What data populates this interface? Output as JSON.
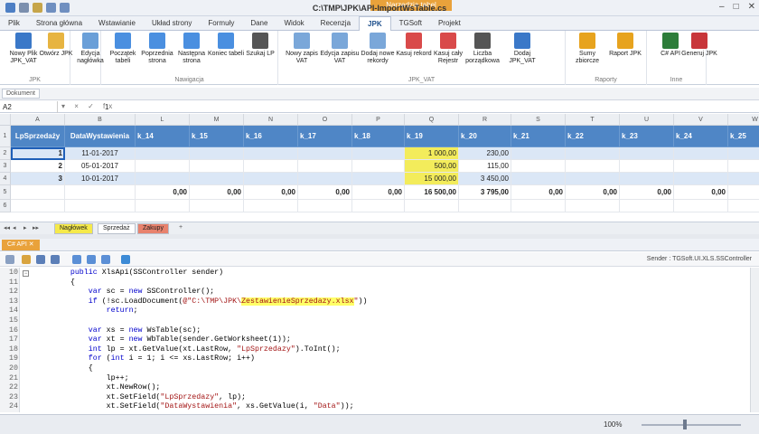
{
  "window": {
    "title": "C:\\TMP\\JPK\\API-ImportWsTable.cs",
    "context_label": "Narzędzia tabel",
    "controls": [
      "–",
      "□",
      "✕"
    ]
  },
  "tabs": [
    "Plik",
    "Strona główna",
    "Wstawianie",
    "Układ strony",
    "Formuły",
    "Dane",
    "Widok",
    "Recenzja",
    "JPK",
    "TGSoft",
    "Projekt"
  ],
  "active_tab": "JPK",
  "ribbon": {
    "groups": [
      {
        "label": "JPK",
        "buttons": [
          {
            "label": "Nowy Plik JPK_VAT",
            "icon": "new-file-icon",
            "color": "#3a78c8"
          },
          {
            "label": "Otwórz JPK",
            "icon": "open-folder-icon",
            "color": "#e7b441"
          }
        ]
      },
      {
        "label": "",
        "buttons": [
          {
            "label": "Edycja nagłówka",
            "icon": "edit-header-icon",
            "color": "#6a9fd8"
          }
        ]
      },
      {
        "label": "Nawigacja",
        "buttons": [
          {
            "label": "Początek tabeli",
            "icon": "first-page-icon",
            "color": "#4a8fe0"
          },
          {
            "label": "Poprzednia strona",
            "icon": "previous-page-icon",
            "color": "#4a8fe0"
          },
          {
            "label": "Następna strona",
            "icon": "next-page-icon",
            "color": "#4a8fe0"
          },
          {
            "label": "Koniec tabeli",
            "icon": "last-page-icon",
            "color": "#4a8fe0"
          },
          {
            "label": "Szukaj LP",
            "icon": "binoculars-icon",
            "color": "#555555"
          }
        ]
      },
      {
        "label": "JPK_VAT",
        "buttons": [
          {
            "label": "Nowy zapis VAT",
            "icon": "new-record-icon",
            "color": "#7aa7d9"
          },
          {
            "label": "Edycja zapisu VAT",
            "icon": "edit-record-icon",
            "color": "#7aa7d9"
          },
          {
            "label": "Dodaj nowe rekordy",
            "icon": "add-records-icon",
            "color": "#7aa7d9"
          },
          {
            "label": "Kasuj rekord",
            "icon": "delete-record-icon",
            "color": "#d94a4a"
          },
          {
            "label": "Kasuj cały Rejestr",
            "icon": "delete-register-icon",
            "color": "#d94a4a"
          },
          {
            "label": "Liczba porządkowa",
            "icon": "numbered-list-icon",
            "color": "#555555"
          },
          {
            "label": "Dodaj JPK_VAT",
            "icon": "add-jpk-icon",
            "color": "#3a78c8"
          }
        ]
      },
      {
        "label": "Raporty",
        "buttons": [
          {
            "label": "Sumy zbiorcze",
            "icon": "sum-icon",
            "color": "#e7a31e"
          },
          {
            "label": "Raport JPK",
            "icon": "report-icon",
            "color": "#e7a31e"
          }
        ]
      },
      {
        "label": "Inne",
        "buttons": [
          {
            "label": "C# API",
            "icon": "csharp-icon",
            "color": "#2d7d3a"
          },
          {
            "label": "Generuj JPK",
            "icon": "generate-icon",
            "color": "#c8363a"
          }
        ]
      }
    ]
  },
  "document_tab": "Dokument",
  "formula_bar": {
    "cell_ref": "A2",
    "icons": "▾ × ✓ fx",
    "value": "1"
  },
  "sheet": {
    "col_letters": [
      "A",
      "B",
      "L",
      "M",
      "N",
      "O",
      "P",
      "Q",
      "R",
      "S",
      "T",
      "U",
      "V",
      "W"
    ],
    "row_numbers": [
      "1",
      "2",
      "3",
      "4",
      "5",
      "6"
    ],
    "header_row": [
      "LpSprzedaży",
      "DataWystawienia",
      "k_14",
      "k_15",
      "k_16",
      "k_17",
      "k_18",
      "k_19",
      "k_20",
      "k_21",
      "k_22",
      "k_23",
      "k_24",
      "k_25"
    ],
    "rows": [
      [
        "1",
        "11-01-2017",
        "",
        "",
        "",
        "",
        "",
        "1 000,00",
        "230,00",
        "",
        "",
        "",
        "",
        ""
      ],
      [
        "2",
        "05-01-2017",
        "",
        "",
        "",
        "",
        "",
        "500,00",
        "115,00",
        "",
        "",
        "",
        "",
        ""
      ],
      [
        "3",
        "10-01-2017",
        "",
        "",
        "",
        "",
        "",
        "15 000,00",
        "3 450,00",
        "",
        "",
        "",
        "",
        ""
      ],
      [
        "",
        "",
        "0,00",
        "0,00",
        "0,00",
        "0,00",
        "0,00",
        "16 500,00",
        "3 795,00",
        "0,00",
        "0,00",
        "0,00",
        "0,00",
        "0,00"
      ],
      [
        "",
        "",
        "",
        "",
        "",
        "",
        "",
        "",
        "",
        "",
        "",
        "",
        "",
        ""
      ]
    ]
  },
  "sheet_tabs": [
    {
      "label": "Nagłówek",
      "color": "#f5e94a"
    },
    {
      "label": "Sprzedaż",
      "color": "#ffffff"
    },
    {
      "label": "Zakupy",
      "color": "#e8826d"
    }
  ],
  "sheet_nav": [
    "◂◂",
    "◂",
    "▸",
    "▸▸",
    "+"
  ],
  "code_panel": {
    "tab": "C# API",
    "sender_label": "Sender : TGSoft.UI.XLS.SSController"
  },
  "code_lines": [
    {
      "n": "10",
      "segs": [
        {
          "t": "        ",
          "c": ""
        },
        {
          "t": "public",
          "c": "kw"
        },
        {
          "t": " XlsApi(SSController sender)",
          "c": ""
        }
      ]
    },
    {
      "n": "11",
      "segs": [
        {
          "t": "        {",
          "c": ""
        }
      ]
    },
    {
      "n": "12",
      "segs": [
        {
          "t": "            ",
          "c": ""
        },
        {
          "t": "var",
          "c": "kw"
        },
        {
          "t": " sc = ",
          "c": ""
        },
        {
          "t": "new",
          "c": "kw"
        },
        {
          "t": " SSController();",
          "c": ""
        }
      ]
    },
    {
      "n": "13",
      "segs": [
        {
          "t": "            ",
          "c": ""
        },
        {
          "t": "if",
          "c": "kw"
        },
        {
          "t": " (!sc.LoadDocument(",
          "c": ""
        },
        {
          "t": "@\"C:\\TMP\\JPK\\",
          "c": "str"
        },
        {
          "t": "ZestawienieSprzedazy.xlsx",
          "c": "str hl"
        },
        {
          "t": "\"",
          "c": "str"
        },
        {
          "t": "))",
          "c": ""
        }
      ]
    },
    {
      "n": "14",
      "segs": [
        {
          "t": "                ",
          "c": ""
        },
        {
          "t": "return",
          "c": "kw"
        },
        {
          "t": ";",
          "c": ""
        }
      ]
    },
    {
      "n": "15",
      "segs": [
        {
          "t": "",
          "c": ""
        }
      ]
    },
    {
      "n": "16",
      "segs": [
        {
          "t": "            ",
          "c": ""
        },
        {
          "t": "var",
          "c": "kw"
        },
        {
          "t": " xs = ",
          "c": ""
        },
        {
          "t": "new",
          "c": "kw"
        },
        {
          "t": " WsTable(sc);",
          "c": ""
        }
      ]
    },
    {
      "n": "17",
      "segs": [
        {
          "t": "            ",
          "c": ""
        },
        {
          "t": "var",
          "c": "kw"
        },
        {
          "t": " xt = ",
          "c": ""
        },
        {
          "t": "new",
          "c": "kw"
        },
        {
          "t": " WbTable(sender.GetWorksheet(1));",
          "c": ""
        }
      ]
    },
    {
      "n": "18",
      "segs": [
        {
          "t": "            ",
          "c": ""
        },
        {
          "t": "int",
          "c": "kw"
        },
        {
          "t": " lp = xt.GetValue(xt.LastRow, ",
          "c": ""
        },
        {
          "t": "\"LpSprzedazy\"",
          "c": "str"
        },
        {
          "t": ").ToInt();",
          "c": ""
        }
      ]
    },
    {
      "n": "19",
      "segs": [
        {
          "t": "            ",
          "c": ""
        },
        {
          "t": "for",
          "c": "kw"
        },
        {
          "t": " (",
          "c": ""
        },
        {
          "t": "int",
          "c": "kw"
        },
        {
          "t": " i = 1; i <= xs.LastRow; i++)",
          "c": ""
        }
      ]
    },
    {
      "n": "20",
      "segs": [
        {
          "t": "            {",
          "c": ""
        }
      ]
    },
    {
      "n": "21",
      "segs": [
        {
          "t": "                lp++;",
          "c": ""
        }
      ]
    },
    {
      "n": "22",
      "segs": [
        {
          "t": "                xt.NewRow();",
          "c": ""
        }
      ]
    },
    {
      "n": "23",
      "segs": [
        {
          "t": "                xt.SetField(",
          "c": ""
        },
        {
          "t": "\"LpSprzedazy\"",
          "c": "str"
        },
        {
          "t": ", lp);",
          "c": ""
        }
      ]
    },
    {
      "n": "24",
      "segs": [
        {
          "t": "                xt.SetField(",
          "c": ""
        },
        {
          "t": "\"DataWystawienia\"",
          "c": "str"
        },
        {
          "t": ", xs.GetValue(i, ",
          "c": ""
        },
        {
          "t": "\"Data\"",
          "c": "str"
        },
        {
          "t": "));",
          "c": ""
        }
      ]
    }
  ],
  "status": {
    "zoom": "100%"
  }
}
